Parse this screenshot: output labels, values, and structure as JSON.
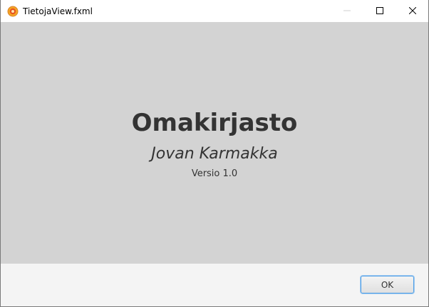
{
  "window": {
    "title": "TietojaView.fxml",
    "icon": "javafx-app-icon",
    "controls": {
      "minimize": "minimize-icon",
      "maximize": "maximize-icon",
      "close": "close-icon"
    }
  },
  "about": {
    "app_name": "Omakirjasto",
    "author": "Jovan Karmakka",
    "version": "Versio 1.0"
  },
  "footer": {
    "ok_label": "OK"
  },
  "colors": {
    "content_bg": "#d3d3d3",
    "footer_bg": "#f4f4f4",
    "text": "#333333",
    "button_focus": "#4c9ee8"
  }
}
